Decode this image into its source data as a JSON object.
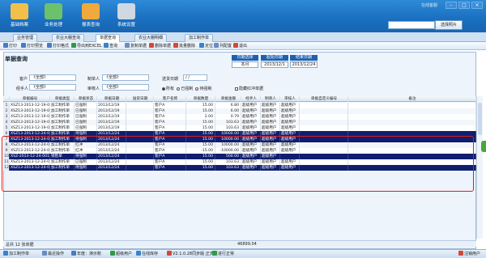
{
  "header": {
    "nav": [
      {
        "label": "基础档案",
        "color": "#f2c04a"
      },
      {
        "label": "业务处理",
        "color": "#6bc26a"
      },
      {
        "label": "报表查询",
        "color": "#f0a93c"
      },
      {
        "label": "系统设置",
        "color": "#cfd8e3"
      }
    ],
    "top_right_text": "在线客服",
    "search_placeholder": "",
    "search_button": "选择照片"
  },
  "tabs": [
    "业务管理",
    "农业大棚查询",
    "单据查询",
    "农业大棚明细",
    "加工制作单"
  ],
  "active_tab": 2,
  "toolbar": [
    "打印",
    "打印预览",
    "打印格式",
    "导出到EXCEL",
    "查询",
    "复制单据",
    "删除单据",
    "批量删除",
    "定位",
    "列配置",
    "退出"
  ],
  "page": {
    "title": "单据查询",
    "date_header": [
      "日期选择",
      "起始日期",
      "结束日期"
    ],
    "date_values": [
      "本月",
      "2013/12/1",
      "2013/12/24"
    ],
    "fields": {
      "customer_label": "客户",
      "customer_value": "《全部》",
      "maker_label": "制单人",
      "maker_value": "《全部》",
      "delivery_label": "送货日期",
      "delivery_value": "/ /",
      "handler_label": "经手人",
      "handler_value": "《全部》",
      "reviewer_label": "审核人",
      "reviewer_value": "《全部》",
      "radio_all": "所有",
      "radio_done": "已强制",
      "radio_wait": "待强制",
      "hide_label": "隐藏红冲单据"
    }
  },
  "grid": {
    "headers": [
      "",
      "单据编号",
      "单据类型",
      "单据状态",
      "单据日期",
      "送货日期",
      "客户名称",
      "单据数量",
      "单据金额",
      "经手人",
      "制单人",
      "审核人",
      "单据自定义编号",
      "备注"
    ],
    "rows": [
      [
        "1",
        "XSZ13-2013-12-19-001",
        "加工制作单",
        "已强制",
        "2013/12/19",
        "",
        "客户A",
        "15.00",
        "6.80",
        "超级用户",
        "超级用户",
        "超级用户",
        "",
        ""
      ],
      [
        "2",
        "XSZ13-2013-12-19-002",
        "加工制作单",
        "已强制",
        "2013/12/19",
        "",
        "客户A",
        "15.00",
        "6.00",
        "超级用户",
        "超级用户",
        "超级用户",
        "",
        ""
      ],
      [
        "3",
        "XSZ13-2013-12-19-003",
        "加工制作单",
        "已强制",
        "2013/12/19",
        "",
        "客户A",
        "2.00",
        "0.79",
        "超级用户",
        "超级用户",
        "超级用户",
        "",
        ""
      ],
      [
        "4",
        "XSZ13-2013-12-19-004",
        "加工制作单",
        "已强制",
        "2013/12/19",
        "",
        "客户A",
        "15.00",
        "103.63",
        "超级用户",
        "超级用户",
        "超级用户",
        "",
        ""
      ],
      [
        "5",
        "XSZ13-2013-12-19-005",
        "加工制作单",
        "已强制",
        "2013/12/19",
        "",
        "客户A",
        "15.00",
        "103.63",
        "超级用户",
        "超级用户",
        "超级用户",
        "",
        ""
      ],
      [
        "6",
        "XSZ13-2013-12-24-001",
        "加工制作单",
        "待强制",
        "2013/12/24",
        "",
        "客户A",
        "15.00",
        "10000.00",
        "超级用户",
        "超级用户",
        "超级用户",
        "",
        ""
      ],
      [
        "7",
        "XSZ13-2013-12-24-002",
        "加工制作单",
        "待强制",
        "2013/12/24",
        "",
        "客户A",
        "15.00",
        "10000.00",
        "超级用户",
        "超级用户",
        "超级用户",
        "",
        ""
      ],
      [
        "8",
        "XSZ13-2013-12-24-004",
        "加工制作单",
        "红冲",
        "2013/12/24",
        "",
        "客户A",
        "15.00",
        "10000.00",
        "超级用户",
        "超级用户",
        "超级用户",
        "",
        ""
      ],
      [
        "9",
        "XSZ13-2013-12-24-004-红冲",
        "加工制作单",
        "红冲",
        "2013/12/24",
        "",
        "客户A",
        "-15.00",
        "-10000.00",
        "超级用户",
        "超级用户",
        "超级用户",
        "",
        ""
      ],
      [
        "10",
        "XSZ-2013-12-24-001",
        "销售单",
        "待强制",
        "2013/12/24",
        "",
        "客户A",
        "15.00",
        "500.00",
        "超级用户",
        "超级用户",
        "",
        "",
        ""
      ],
      [
        "11",
        "XSZ13-2013-12-24-005",
        "加工制作单",
        "已强制",
        "2013/12/24",
        "",
        "客户A",
        "15.00",
        "103.63",
        "超级用户",
        "超级用户",
        "超级用户",
        "",
        ""
      ],
      [
        "12",
        "XSZ13-2013-12-24-006",
        "加工制作单",
        "待强制",
        "2013/12/24",
        "",
        "客户A",
        "15.00",
        "103.63",
        "超级用户",
        "超级用户",
        "超级用户",
        "",
        ""
      ]
    ],
    "selected_rows": [
      5,
      6,
      9,
      11
    ],
    "summary_label": "总共 12 张单据",
    "summary_amount": "46899.04"
  },
  "status": {
    "items": [
      "加工制作单",
      "最近操作",
      "年度：演示账",
      "超级用户",
      "在线库存",
      "V2.1.0.28同步版 正式版",
      "进行正常"
    ],
    "right": "注销用户"
  },
  "colors": {
    "banner": "#1a6fc0",
    "selected_row": "#0f1e6e",
    "highlight_border": "#d62020"
  }
}
